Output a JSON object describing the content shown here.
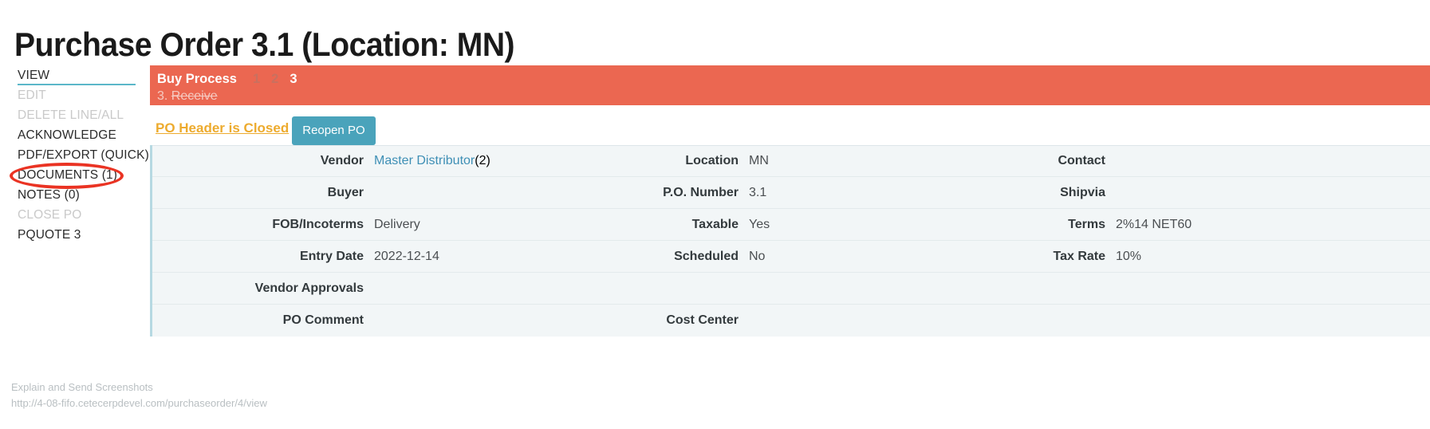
{
  "page": {
    "title": "Purchase Order 3.1 (Location: MN)"
  },
  "sidebar": {
    "items": [
      {
        "label": "VIEW",
        "state": "active"
      },
      {
        "label": "EDIT",
        "state": "disabled"
      },
      {
        "label": "DELETE LINE/ALL",
        "state": "disabled"
      },
      {
        "label": "ACKNOWLEDGE",
        "state": "normal"
      },
      {
        "label": "PDF/EXPORT (QUICK)",
        "state": "normal"
      },
      {
        "label": "DOCUMENTS (1)",
        "state": "normal"
      },
      {
        "label": "NOTES (0)",
        "state": "normal"
      },
      {
        "label": "CLOSE PO",
        "state": "disabled"
      },
      {
        "label": "PQUOTE 3",
        "state": "normal"
      }
    ],
    "annotation_target": "DOCUMENTS (1)",
    "annotation_color": "#ea3323"
  },
  "buy_process": {
    "label": "Buy Process",
    "steps": [
      "1",
      "2",
      "3"
    ],
    "current_step": "3",
    "current_step_text_prefix": "3. ",
    "current_step_text_struck": "Receive",
    "background_color": "#eb6751"
  },
  "closed_bar": {
    "status_link": "PO Header is Closed",
    "status_color": "#edab2e",
    "reopen_button": "Reopen PO",
    "reopen_button_color": "#4aa3bb"
  },
  "details": {
    "rows": [
      {
        "c1": {
          "label": "Vendor",
          "value": "Master Distributor",
          "value_is_link": true,
          "suffix": " (2)"
        },
        "c2": {
          "label": "Location",
          "value": "MN"
        },
        "c3": {
          "label": "Contact",
          "value": ""
        }
      },
      {
        "c1": {
          "label": "Buyer",
          "value": ""
        },
        "c2": {
          "label": "P.O. Number",
          "value": "3.1"
        },
        "c3": {
          "label": "Shipvia",
          "value": ""
        }
      },
      {
        "c1": {
          "label": "FOB/Incoterms",
          "value": "Delivery"
        },
        "c2": {
          "label": "Taxable",
          "value": "Yes"
        },
        "c3": {
          "label": "Terms",
          "value": "2%14 NET60"
        }
      },
      {
        "c1": {
          "label": "Entry Date",
          "value": "2022-12-14"
        },
        "c2": {
          "label": "Scheduled",
          "value": "No"
        },
        "c3": {
          "label": "Tax Rate",
          "value": "10%"
        }
      },
      {
        "c1": {
          "label": "Vendor Approvals",
          "value": ""
        },
        "c2": {
          "label": "",
          "value": ""
        },
        "c3": {
          "label": "",
          "value": ""
        }
      },
      {
        "c1": {
          "label": "PO Comment",
          "value": ""
        },
        "c2": {
          "label": "Cost Center",
          "value": ""
        },
        "c3": {
          "label": "",
          "value": ""
        }
      }
    ]
  },
  "overlay": {
    "line1": "Explain and Send Screenshots",
    "line2": "http://4-08-fifo.cetecerpdevel.com/purchaseorder/4/view"
  }
}
